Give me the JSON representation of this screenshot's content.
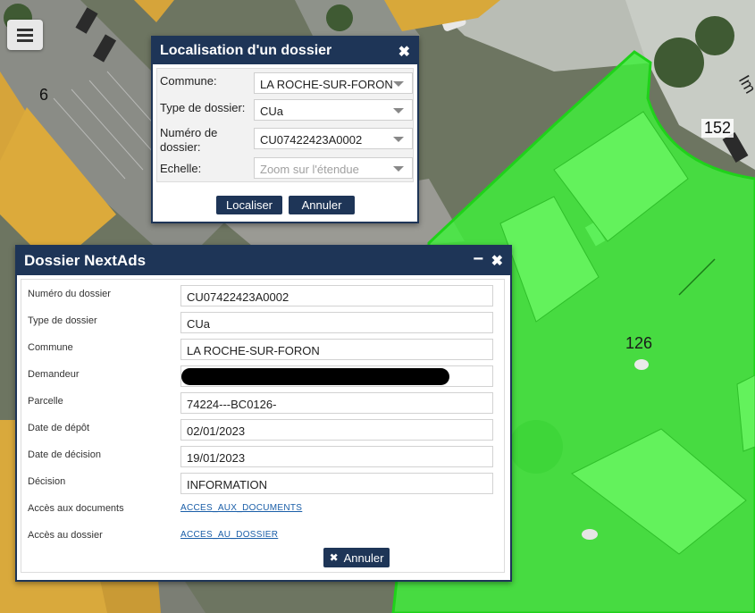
{
  "map": {
    "parcel_labels": [
      "6",
      "152",
      "126",
      "Im"
    ]
  },
  "icons": {
    "menu": "hamburger-menu-icon",
    "close": "close-icon",
    "minimize": "minimize-icon",
    "dropdown": "dropdown-arrow-icon"
  },
  "colors": {
    "window_title_bg": "#1e3557",
    "highlight_fill": "#3ef23a",
    "link": "#1a5ea8"
  },
  "localisation": {
    "title": "Localisation d'un dossier",
    "commune_label": "Commune:",
    "commune_value": "LA ROCHE-SUR-FORON",
    "type_label": "Type de dossier:",
    "type_value": "CUa",
    "numero_label_1": "Numéro de",
    "numero_label_2": "dossier:",
    "numero_value": "CU07422423A0002",
    "echelle_label": "Echelle:",
    "echelle_placeholder": "Zoom sur l'étendue",
    "localiser_button": "Localiser",
    "annuler_button": "Annuler"
  },
  "nextads": {
    "title": "Dossier NextAds",
    "fields": [
      {
        "label": "Numéro du dossier",
        "value": "CU07422423A0002"
      },
      {
        "label": "Type de dossier",
        "value": "CUa"
      },
      {
        "label": "Commune",
        "value": "LA ROCHE-SUR-FORON"
      },
      {
        "label": "Demandeur",
        "value": ""
      },
      {
        "label": "Parcelle",
        "value": "74224---BC0126-"
      },
      {
        "label": "Date de dépôt",
        "value": "02/01/2023"
      },
      {
        "label": "Date de décision",
        "value": "19/01/2023"
      },
      {
        "label": "Décision",
        "value": "INFORMATION"
      }
    ],
    "links": [
      {
        "label": "Accès aux documents",
        "text": "ACCES_AUX_DOCUMENTS"
      },
      {
        "label": "Accès au dossier",
        "text": "ACCES_AU_DOSSIER"
      }
    ],
    "annuler_button": "Annuler"
  }
}
